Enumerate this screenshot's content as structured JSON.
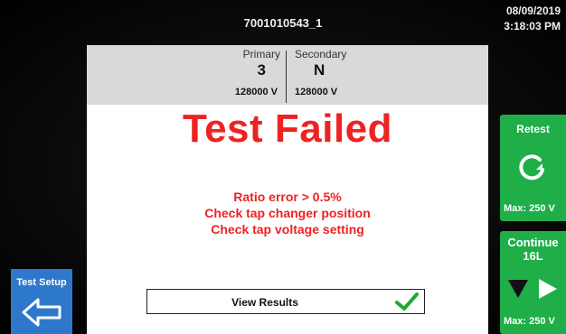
{
  "header": {
    "title": "7001010543_1",
    "date": "08/09/2019",
    "time": "3:18:03 PM"
  },
  "windings": {
    "primary": {
      "label": "Primary",
      "value": "3",
      "voltage": "128000 V"
    },
    "secondary": {
      "label": "Secondary",
      "value": "N",
      "voltage": "128000 V"
    }
  },
  "result": {
    "title": "Test Failed",
    "messages": [
      "Ratio error > 0.5%",
      "Check tap changer position",
      "Check tap voltage setting"
    ],
    "view_results_label": "View Results"
  },
  "buttons": {
    "retest": {
      "label": "Retest",
      "max": "Max: 250 V",
      "icon": "refresh-icon"
    },
    "continue": {
      "label": "Continue",
      "tap": "16L",
      "max": "Max: 250 V",
      "icons": [
        "arrow-down-icon",
        "arrow-right-icon"
      ]
    },
    "test_setup": {
      "label": "Test Setup",
      "icon": "arrow-left-icon"
    }
  },
  "colors": {
    "fail": "#ee2222",
    "action": "#1fae48",
    "nav": "#2e78cc",
    "check": "#22aa33"
  }
}
